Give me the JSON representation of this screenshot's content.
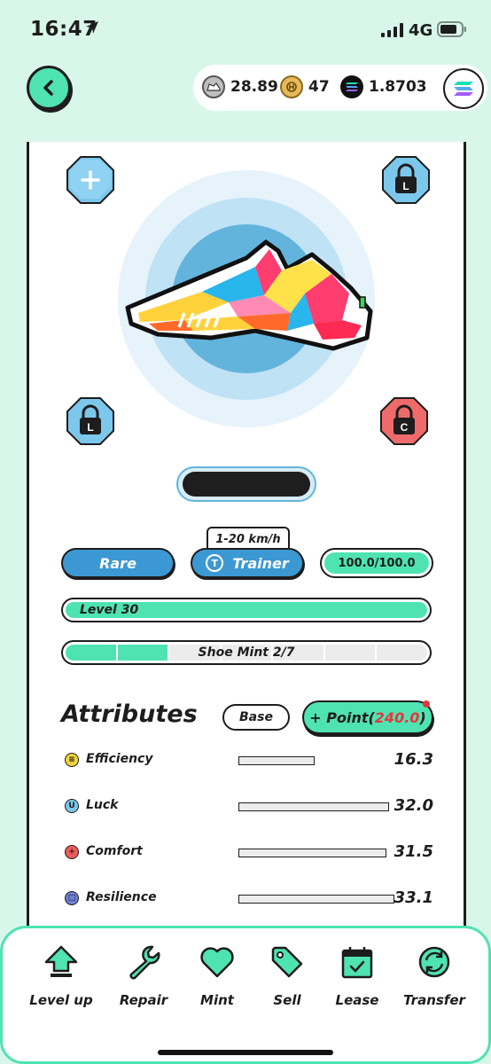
{
  "status": {
    "time": "16:47",
    "network": "4G"
  },
  "header": {
    "balances": [
      {
        "icon": "sneaker-token-icon",
        "amount": "28.89"
      },
      {
        "icon": "gmt-coin-icon",
        "amount": "47"
      },
      {
        "icon": "solana-icon",
        "amount": "1.8703"
      }
    ]
  },
  "sneaker": {
    "slots": [
      {
        "name": "add-gem-slot",
        "symbol": "+"
      },
      {
        "name": "locked-slot-top-right",
        "symbol": "L"
      },
      {
        "name": "locked-slot-bottom-left",
        "symbol": "L"
      },
      {
        "name": "locked-slot-bottom-right",
        "symbol": "C"
      }
    ],
    "speed_range": "1-20 km/h",
    "rarity": "Rare",
    "type_badge": "T",
    "type": "Trainer",
    "durability": "100.0/100.0",
    "level_label": "Level 30",
    "shoe_mint": {
      "label": "Shoe Mint 2/7",
      "used": 2,
      "total": 7
    }
  },
  "attributes": {
    "title": "Attributes",
    "base_label": "Base",
    "point_prefix": "+ Point(",
    "point_value": "240.0",
    "point_suffix": ")",
    "items": [
      {
        "label": "Efficiency",
        "value": "16.3",
        "fill": 0.49,
        "color": "#f2d33c",
        "glyph": "≡"
      },
      {
        "label": "Luck",
        "value": "32.0",
        "fill": 0.965,
        "color": "#7cc7ec",
        "glyph": "U"
      },
      {
        "label": "Comfort",
        "value": "31.5",
        "fill": 0.95,
        "color": "#ef5b5b",
        "glyph": "+"
      },
      {
        "label": "Resilience",
        "value": "33.1",
        "fill": 1.0,
        "color": "#6f7fd6",
        "glyph": "□"
      }
    ]
  },
  "nav": {
    "items": [
      {
        "label": "Level up",
        "icon": "level-up-arrow-icon"
      },
      {
        "label": "Repair",
        "icon": "wrench-icon"
      },
      {
        "label": "Mint",
        "icon": "heart-icon"
      },
      {
        "label": "Sell",
        "icon": "price-tag-icon"
      },
      {
        "label": "Lease",
        "icon": "calendar-icon"
      },
      {
        "label": "Transfer",
        "icon": "transfer-icon"
      }
    ]
  },
  "colors": {
    "accent": "#4fe3b2",
    "background": "#d8f7ea",
    "blue": "#3c98d2",
    "red_value": "#e4373b"
  }
}
